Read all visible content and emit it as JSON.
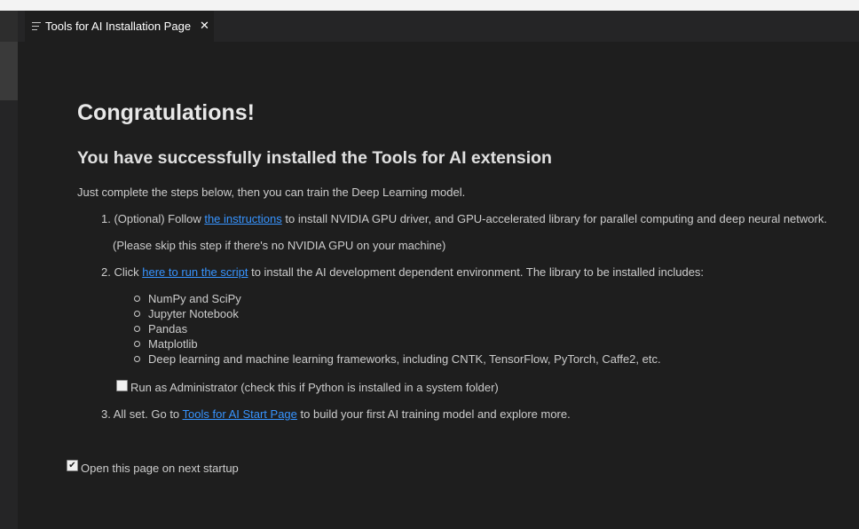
{
  "tab": {
    "title": "Tools for AI Installation Page",
    "icon": "file-lines-icon",
    "close_symbol": "✕"
  },
  "page": {
    "heading": "Congratulations!",
    "subheading": "You have successfully installed the Tools for AI extension",
    "intro": "Just complete the steps below, then you can train the Deep Learning model.",
    "step1": {
      "prefix": "1. (Optional) Follow ",
      "link": "the instructions",
      "suffix": " to install NVIDIA GPU driver, and GPU-accelerated library for parallel computing and deep neural network.",
      "note": "(Please skip this step if there's no NVIDIA GPU on your machine)"
    },
    "step2": {
      "prefix": "2. Click ",
      "link": "here to run the script",
      "suffix": " to install the AI development dependent environment. The library to be installed includes:",
      "libraries": [
        "NumPy and SciPy",
        "Jupyter Notebook",
        "Pandas",
        "Matplotlib",
        "Deep learning and machine learning frameworks, including CNTK, TensorFlow, PyTorch, Caffe2, etc."
      ],
      "admin_checkbox_label": "Run as Administrator (check this if Python is installed in a system folder)",
      "admin_checked": false
    },
    "step3": {
      "prefix": "3. All set. Go to ",
      "link": "Tools for AI Start Page",
      "suffix": " to build your first AI training model and explore more."
    },
    "startup_checkbox_label": "Open this page on next startup",
    "startup_checked": true
  },
  "colors": {
    "background": "#1e1e1e",
    "link": "#3794ff",
    "text": "#cccccc"
  }
}
